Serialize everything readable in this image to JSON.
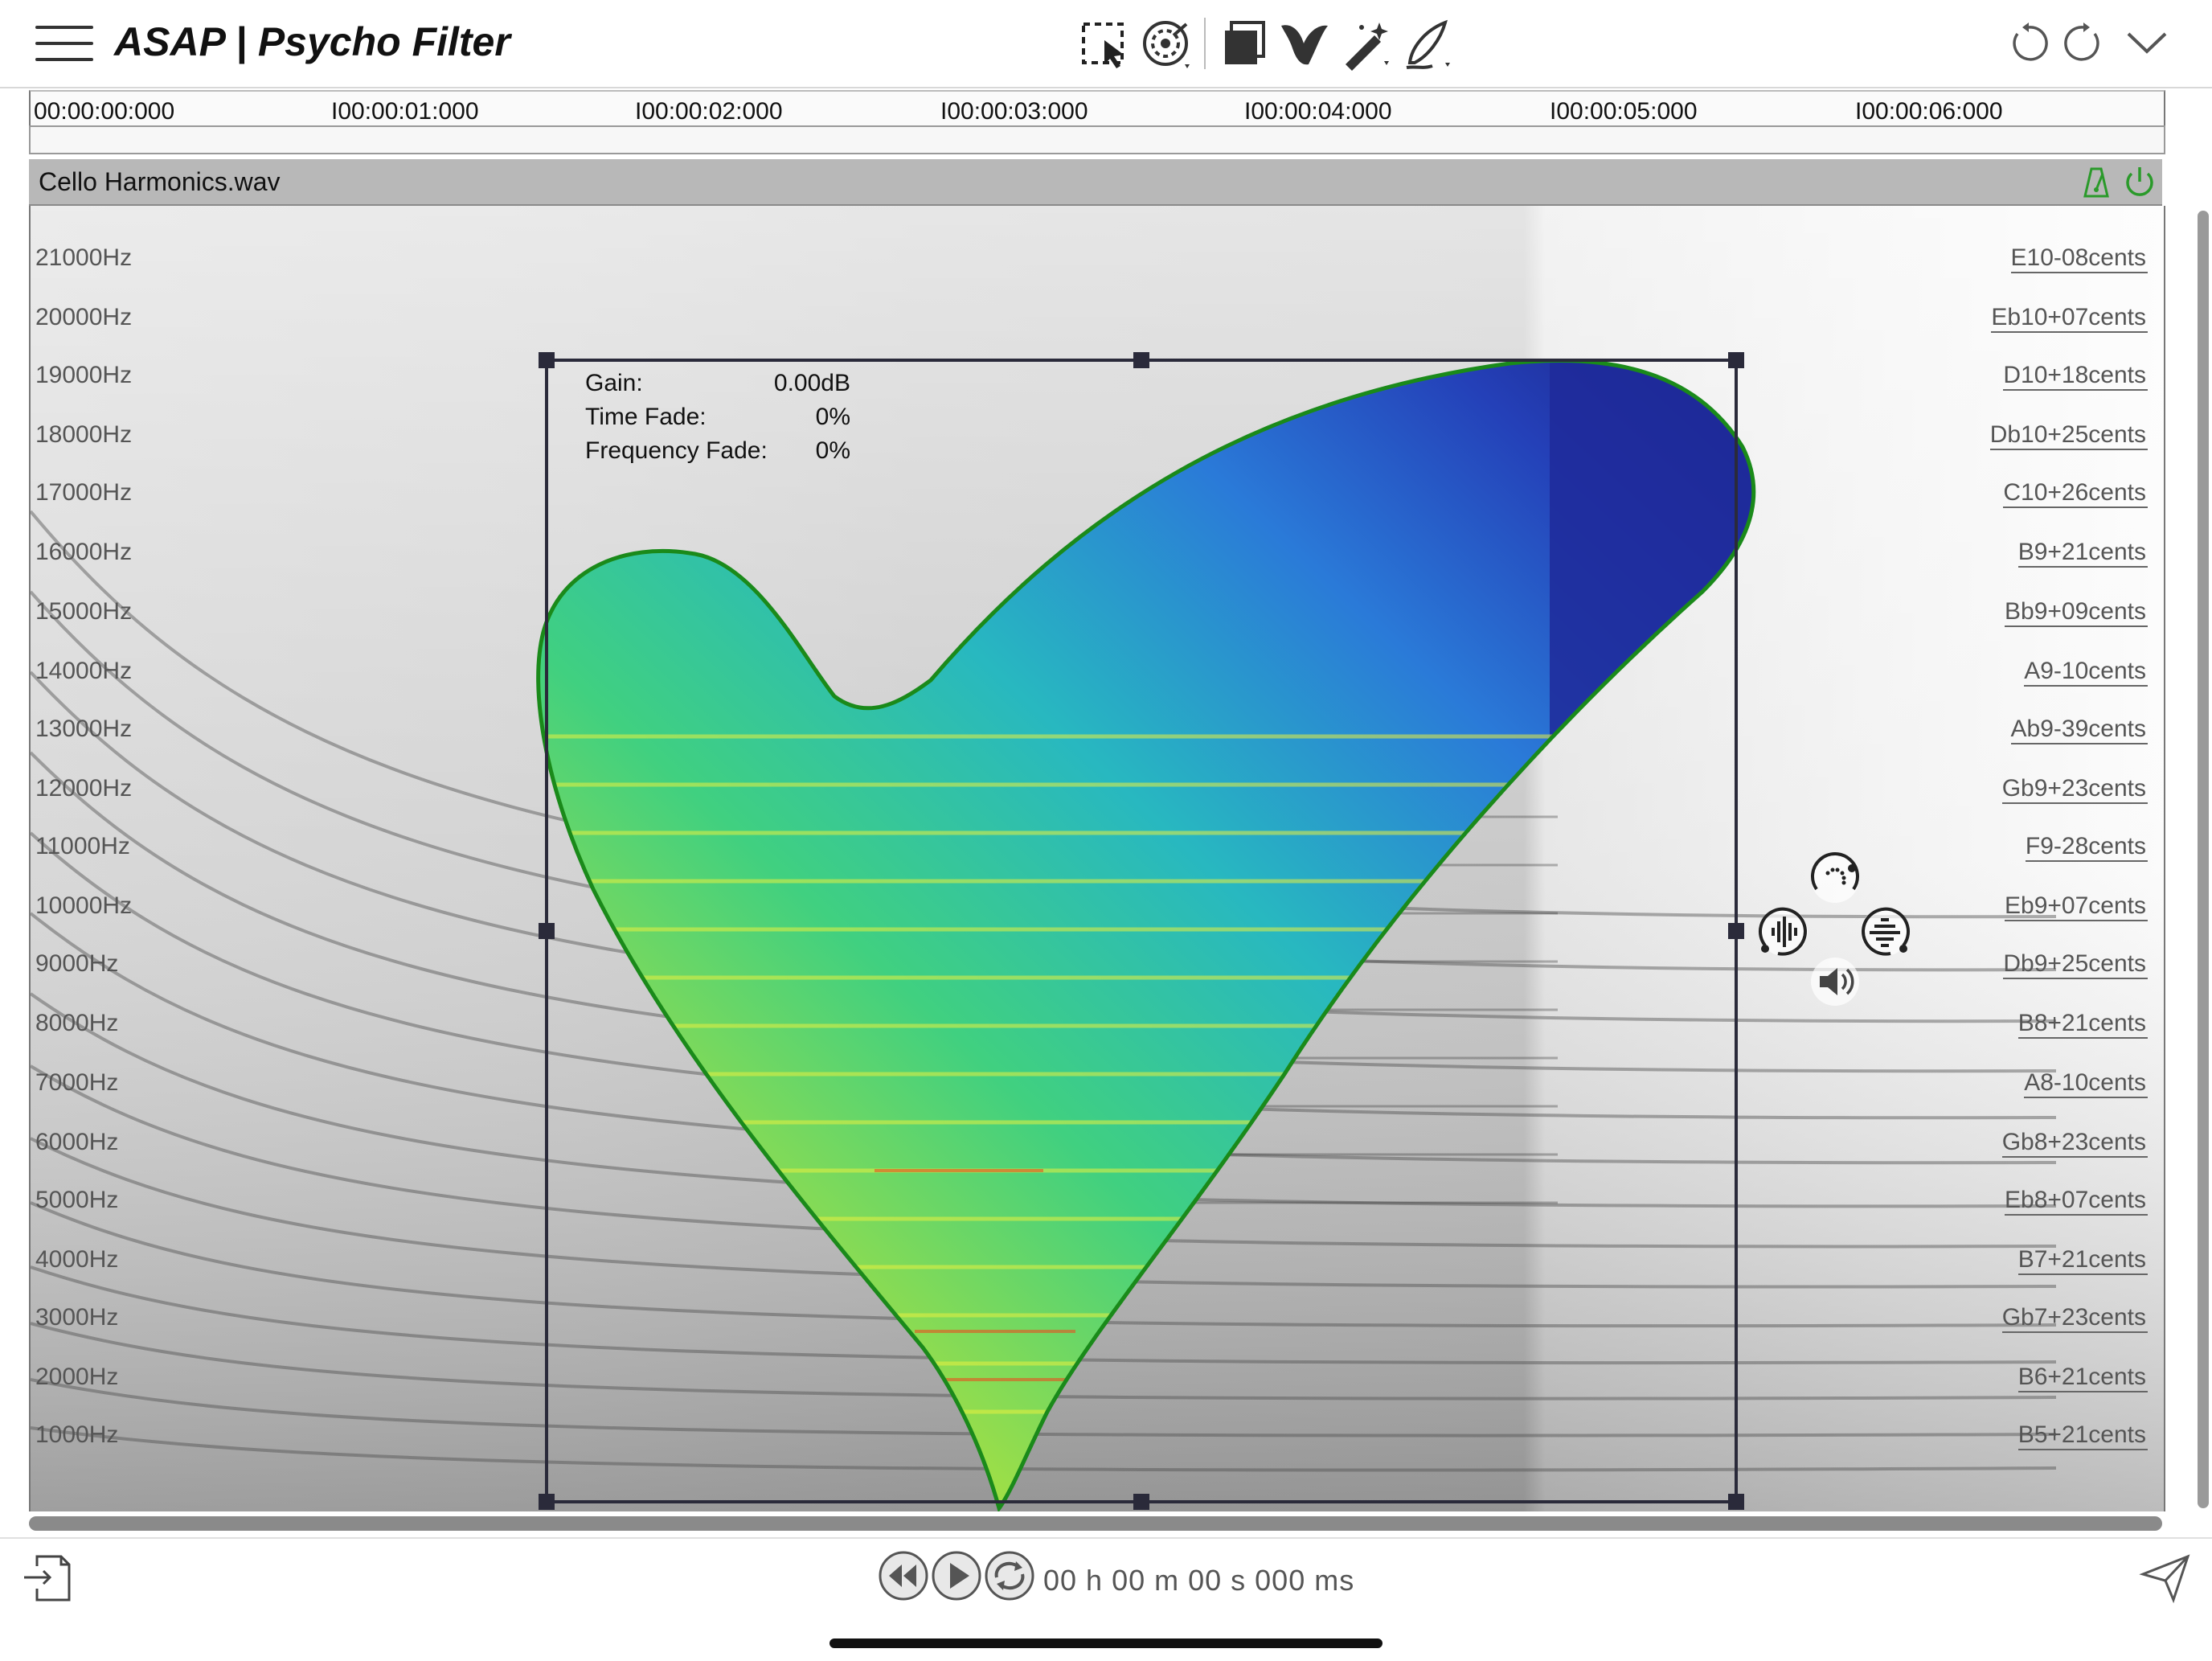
{
  "app": {
    "title": "ASAP | Psycho Filter"
  },
  "toolbar": {
    "icons": [
      "rect-select-icon",
      "lasso-radial-icon",
      "layers-icon",
      "brush-shape-icon",
      "magic-wand-icon",
      "pen-icon"
    ],
    "right_icons": [
      "undo-icon",
      "redo-icon",
      "chevron-down-icon"
    ]
  },
  "timeline": {
    "ticks": [
      "00:00:00:000",
      "I00:00:01:000",
      "I00:00:02:000",
      "I00:00:03:000",
      "I00:00:04:000",
      "I00:00:05:000",
      "I00:00:06:000"
    ]
  },
  "track": {
    "name": "Cello Harmonics.wav",
    "icons": [
      "metronome-icon",
      "power-icon"
    ]
  },
  "frequency_labels": [
    "21000Hz",
    "20000Hz",
    "19000Hz",
    "18000Hz",
    "17000Hz",
    "16000Hz",
    "15000Hz",
    "14000Hz",
    "13000Hz",
    "12000Hz",
    "11000Hz",
    "10000Hz",
    "9000Hz",
    "8000Hz",
    "7000Hz",
    "6000Hz",
    "5000Hz",
    "4000Hz",
    "3000Hz",
    "2000Hz",
    "1000Hz"
  ],
  "pitch_labels": [
    "E10-08cents",
    "Eb10+07cents",
    "D10+18cents",
    "Db10+25cents",
    "C10+26cents",
    "B9+21cents",
    "Bb9+09cents",
    "A9-10cents",
    "Ab9-39cents",
    "Gb9+23cents",
    "F9-28cents",
    "Eb9+07cents",
    "Db9+25cents",
    "B8+21cents",
    "A8-10cents",
    "Gb8+23cents",
    "Eb8+07cents",
    "B7+21cents",
    "Gb7+23cents",
    "B6+21cents",
    "B5+21cents"
  ],
  "selection": {
    "gain_label": "Gain:",
    "gain_value": "0.00dB",
    "time_fade_label": "Time Fade:",
    "time_fade_value": "0%",
    "freq_fade_label": "Frequency Fade:",
    "freq_fade_value": "0%"
  },
  "selection_controls": [
    "gain-knob-icon",
    "waveform-icon",
    "spectrum-filter-icon",
    "speaker-icon"
  ],
  "transport": {
    "time_readout": "00 h  00 m  00 s  000 ms",
    "icons": [
      "rewind-icon",
      "play-icon",
      "loop-icon"
    ]
  },
  "bottom_icons": [
    "import-icon",
    "share-icon"
  ],
  "colors": {
    "selection_outline": "#1a8a1a",
    "accent_green": "#2a9a2a",
    "box_border": "#2a2a3a"
  }
}
